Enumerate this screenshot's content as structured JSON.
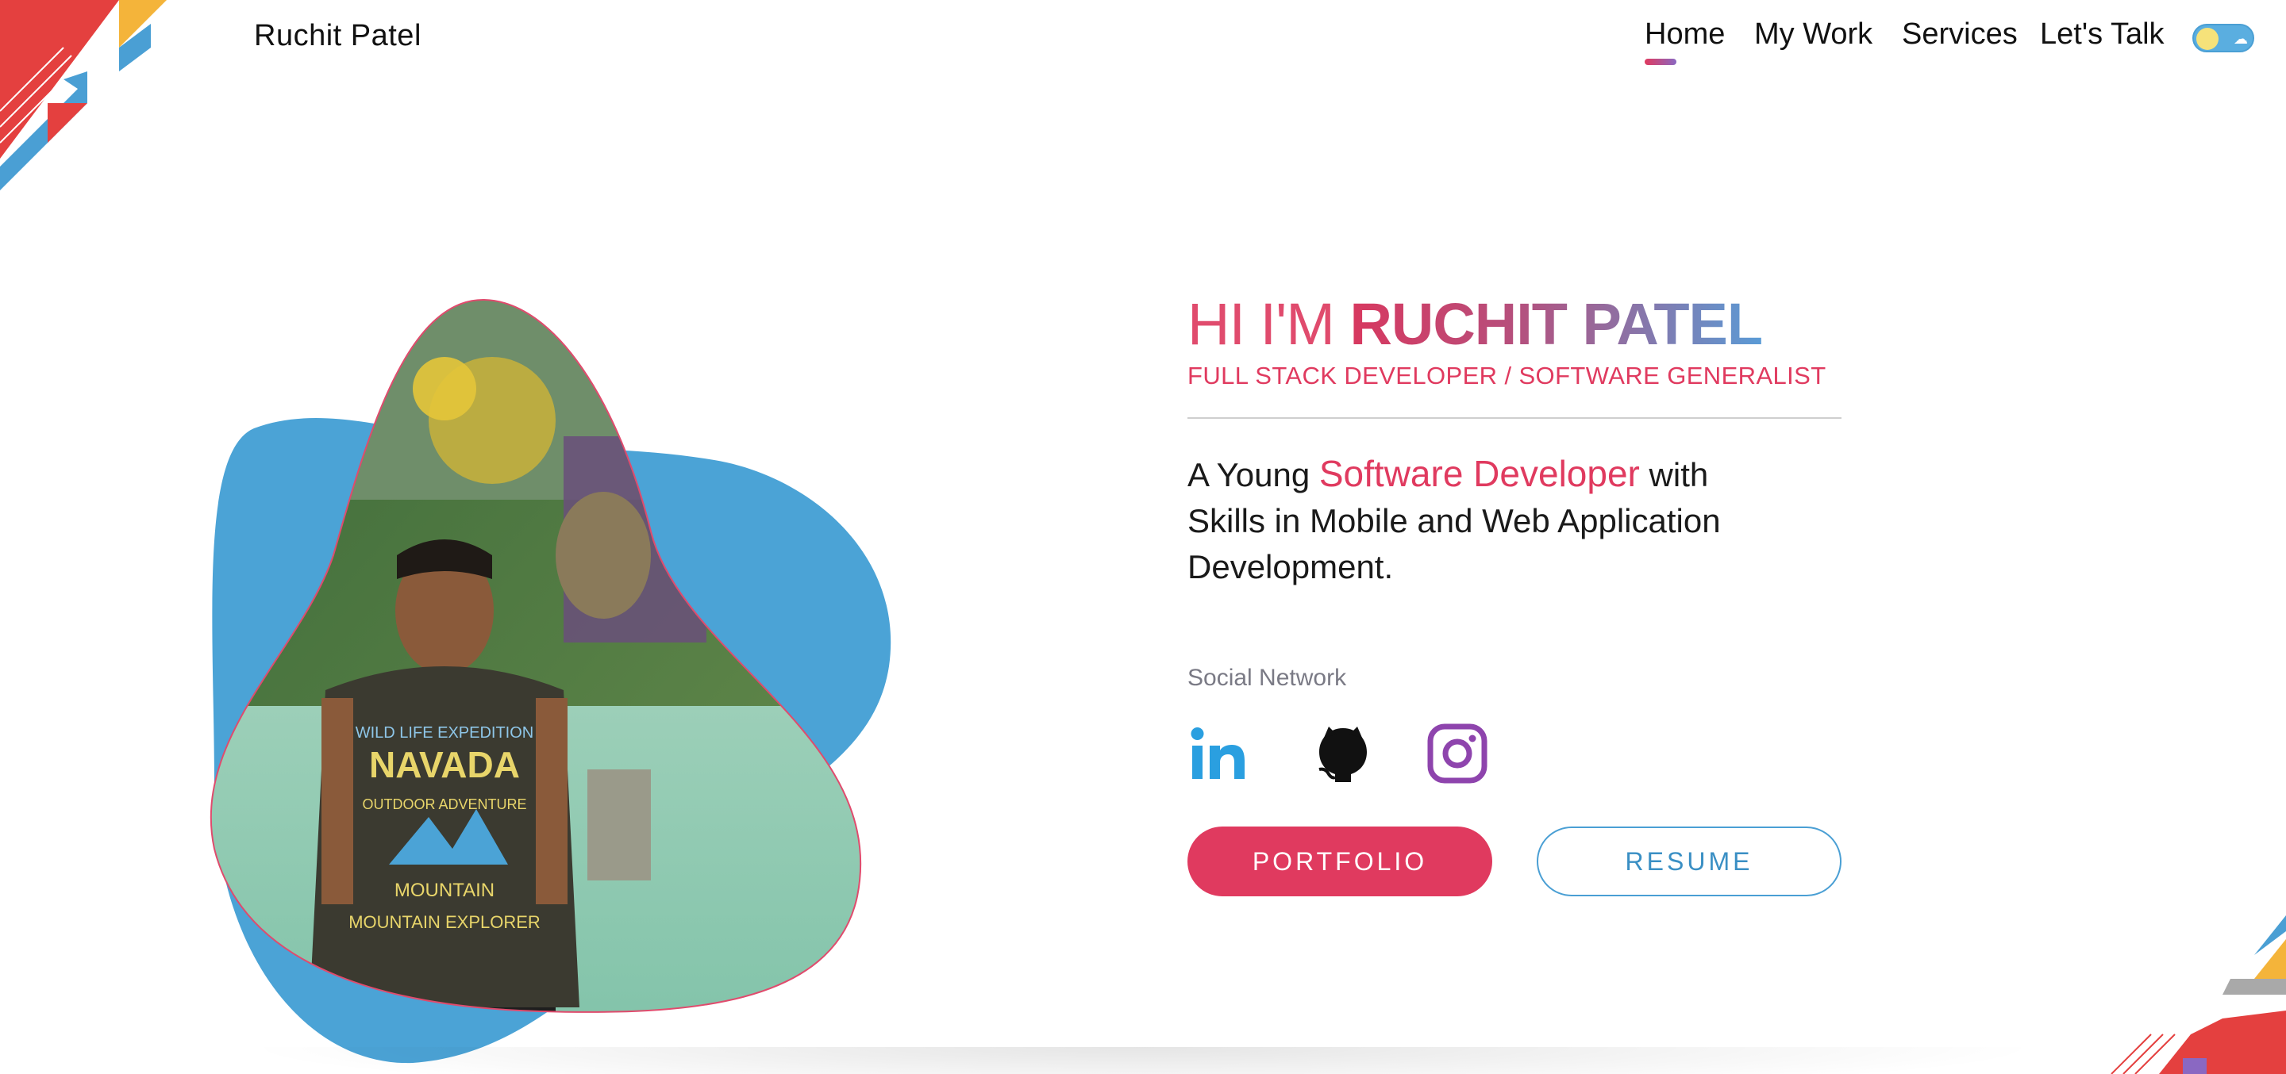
{
  "header": {
    "brand": "Ruchit Patel",
    "nav": [
      {
        "label": "Home",
        "active": true
      },
      {
        "label": "My Work",
        "active": false
      },
      {
        "label": "Services",
        "active": false
      },
      {
        "label": "Let's Talk",
        "active": false
      }
    ],
    "theme_toggle": {
      "icons": [
        "sun-icon",
        "cloud-icon"
      ]
    }
  },
  "hero": {
    "greeting": "HI I'M",
    "name": "RUCHIT PATEL",
    "subtitle": "FULL STACK DEVELOPER / SOFTWARE GENERALIST",
    "desc_prefix": "A Young",
    "desc_highlight": "Software Developer",
    "desc_suffix": "with",
    "desc_line2": "Skills in Mobile and Web Application",
    "desc_line3": "Development.",
    "social_label": "Social Network",
    "social": [
      {
        "name": "linkedin-icon",
        "color": "#2a9fe0"
      },
      {
        "name": "github-icon",
        "color": "#111111"
      },
      {
        "name": "instagram-icon",
        "color": "#8e44ad"
      }
    ],
    "buttons": {
      "portfolio": "PORTFOLIO",
      "resume": "RESUME"
    },
    "photo_shirt_text": [
      "WILD LIFE EXPEDITION",
      "NAVADA",
      "OUTDOOR ADVENTURE",
      "MOUNTAIN",
      "MOUNTAIN EXPLORER"
    ]
  },
  "colors": {
    "accent": "#e03a5f",
    "blue": "#4ba3d6",
    "purple": "#8a68c2"
  }
}
